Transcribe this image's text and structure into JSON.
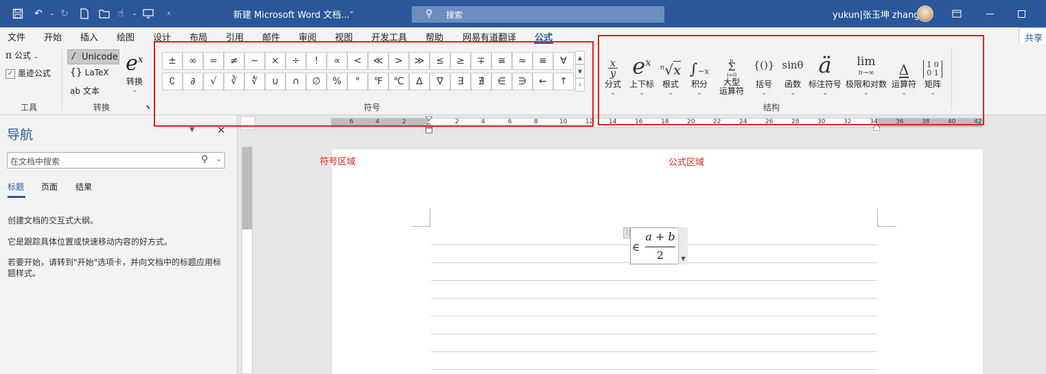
{
  "titlebar": {
    "document_title": "新建 Microsoft Word 文档...",
    "search_label": "搜索",
    "user_name": "yukun|张玉坤 zhang"
  },
  "menu": {
    "tabs": [
      "文件",
      "开始",
      "插入",
      "绘图",
      "设计",
      "布局",
      "引用",
      "邮件",
      "审阅",
      "视图",
      "开发工具",
      "帮助",
      "网易有道翻译",
      "公式"
    ],
    "active_tab": "公式",
    "share_label": "共享"
  },
  "ribbon": {
    "tools": {
      "equation_label": "公式",
      "ink_equation_label": "墨迹公式",
      "group_label": "工具"
    },
    "conversions": {
      "unicode_label": "Unicode",
      "latex_label": "LaTeX",
      "text_label": "文本",
      "convert_label": "转换",
      "group_label": "转换"
    },
    "symbols": {
      "row1": [
        "±",
        "∞",
        "=",
        "≠",
        "~",
        "×",
        "÷",
        "!",
        "∝",
        "<",
        "≪",
        ">",
        "≫",
        "≤",
        "≥",
        "∓",
        "≅",
        "≈",
        "≡",
        "∀"
      ],
      "row2": [
        "∁",
        "∂",
        "√",
        "∛",
        "∜",
        "∪",
        "∩",
        "∅",
        "%",
        "°",
        "℉",
        "℃",
        "∆",
        "∇",
        "∃",
        "∄",
        "∈",
        "∋",
        "←",
        "↑"
      ],
      "group_label": "符号"
    },
    "structures": {
      "items": [
        {
          "label": "分式",
          "icon": "fraction-icon"
        },
        {
          "label": "上下标",
          "icon": "script-icon"
        },
        {
          "label": "根式",
          "icon": "radical-icon"
        },
        {
          "label": "积分",
          "icon": "integral-icon"
        },
        {
          "label": "大型\n运算符",
          "icon": "large-operator-icon"
        },
        {
          "label": "括号",
          "icon": "bracket-icon"
        },
        {
          "label": "函数",
          "icon": "function-icon"
        },
        {
          "label": "标注符号",
          "icon": "accent-icon"
        },
        {
          "label": "极限和对数",
          "icon": "limit-icon"
        },
        {
          "label": "运算符",
          "icon": "operator-icon"
        },
        {
          "label": "矩阵",
          "icon": "matrix-icon"
        }
      ],
      "group_label": "结构"
    }
  },
  "ruler": {
    "left_numbers": [
      "6",
      "4",
      "2",
      "2",
      "4",
      "6",
      "8",
      "10",
      "12"
    ],
    "right_numbers": [
      "14",
      "16",
      "18",
      "20",
      "22",
      "24",
      "26",
      "28",
      "30",
      "32",
      "34",
      "36",
      "38",
      "40",
      "42"
    ]
  },
  "navigation": {
    "title": "导航",
    "search_placeholder": "在文档中搜索",
    "tabs": [
      "标题",
      "页面",
      "结果"
    ],
    "active_tab": "标题",
    "paragraphs": [
      "创建文档的交互式大纲。",
      "它是跟踪具体位置或快速移动内容的好方式。",
      "若要开始，请转到\"开始\"选项卡，并向文档中的标题应用标题样式。"
    ]
  },
  "annotations": {
    "symbol_area": "符号区域",
    "formula_area": "公式区域"
  },
  "equation": {
    "element_of": "∈",
    "numerator": "a + b",
    "denominator": "2"
  },
  "colors": {
    "title_bar": "#2b579a",
    "annotation_red": "#e0201f"
  }
}
